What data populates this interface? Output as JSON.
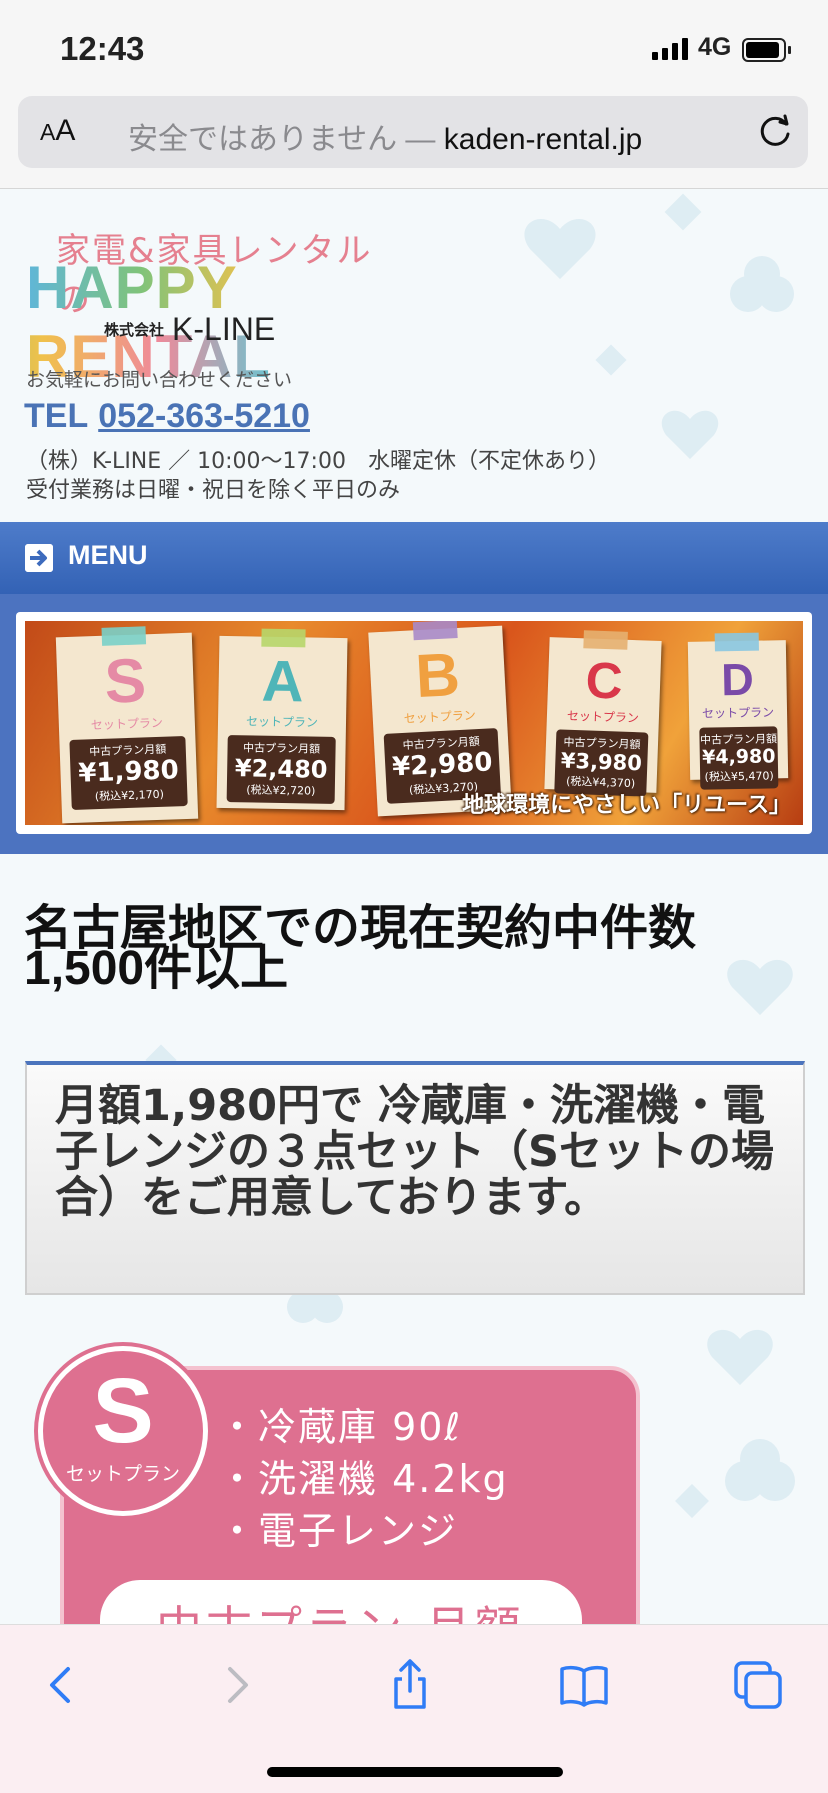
{
  "status_bar": {
    "time": "12:43",
    "network": "4G"
  },
  "url_bar": {
    "text_size_label": "AA",
    "insecure_label": "安全ではありません —",
    "domain": "kaden-rental.jp"
  },
  "header": {
    "logo_line1": "家電&家具レンタルの",
    "logo_line2": "HAPPY RENTAL",
    "logo_company_kind": "株式会社",
    "logo_company": "K-LINE",
    "contact_note": "お気軽にお問い合わせください",
    "tel_prefix": "TEL",
    "tel_number": "052-363-5210",
    "hours": "（株）K-LINE ／ 10:00〜17:00　水曜定休（不定休あり）",
    "reception": "受付業務は日曜・祝日を除く平日のみ"
  },
  "menu": {
    "label": "MENU"
  },
  "banner": {
    "plans": [
      {
        "letter": "S",
        "set": "セットプラン",
        "price_label": "中古プラン月額",
        "price": "¥1,980",
        "tax": "(税込¥2,170)",
        "color": "#e58aa5",
        "tape": "#7ad0c8"
      },
      {
        "letter": "A",
        "set": "セットプラン",
        "price_label": "中古プラン月額",
        "price": "¥2,480",
        "tax": "(税込¥2,720)",
        "color": "#4fb5b8",
        "tape": "#b7d66a"
      },
      {
        "letter": "B",
        "set": "セットプラン",
        "price_label": "中古プラン月額",
        "price": "¥2,980",
        "tax": "(税込¥3,270)",
        "color": "#f0a040",
        "tape": "#a98ac8"
      },
      {
        "letter": "C",
        "set": "セットプラン",
        "price_label": "中古プラン月額",
        "price": "¥3,980",
        "tax": "(税込¥4,370)",
        "color": "#d9374a",
        "tape": "#e6b070"
      },
      {
        "letter": "D",
        "set": "セットプラン",
        "price_label": "中古プラン月額",
        "price": "¥4,980",
        "tax": "(税込¥5,470)",
        "color": "#7a4aa8",
        "tape": "#8ac6e0"
      }
    ],
    "slogan": "地球環境にやさしい「リユース」"
  },
  "main": {
    "headline": "名古屋地区での現在契約中件数 1,500件以上",
    "info": "月額1,980円で 冷蔵庫・洗濯機・電子レンジの３点セット（Sセットの場合）をご用意しております。",
    "plan_s": {
      "letter": "S",
      "set": "セットプラン",
      "items": [
        "・冷蔵庫 90ℓ",
        "・洗濯機 4.2kg",
        "・電子レンジ"
      ],
      "price_label": "中古プラン 月額"
    }
  },
  "colors": {
    "accent": "#4a73b5",
    "menu_bar": "#3d6bbd",
    "plan_pink": "#de7090"
  }
}
